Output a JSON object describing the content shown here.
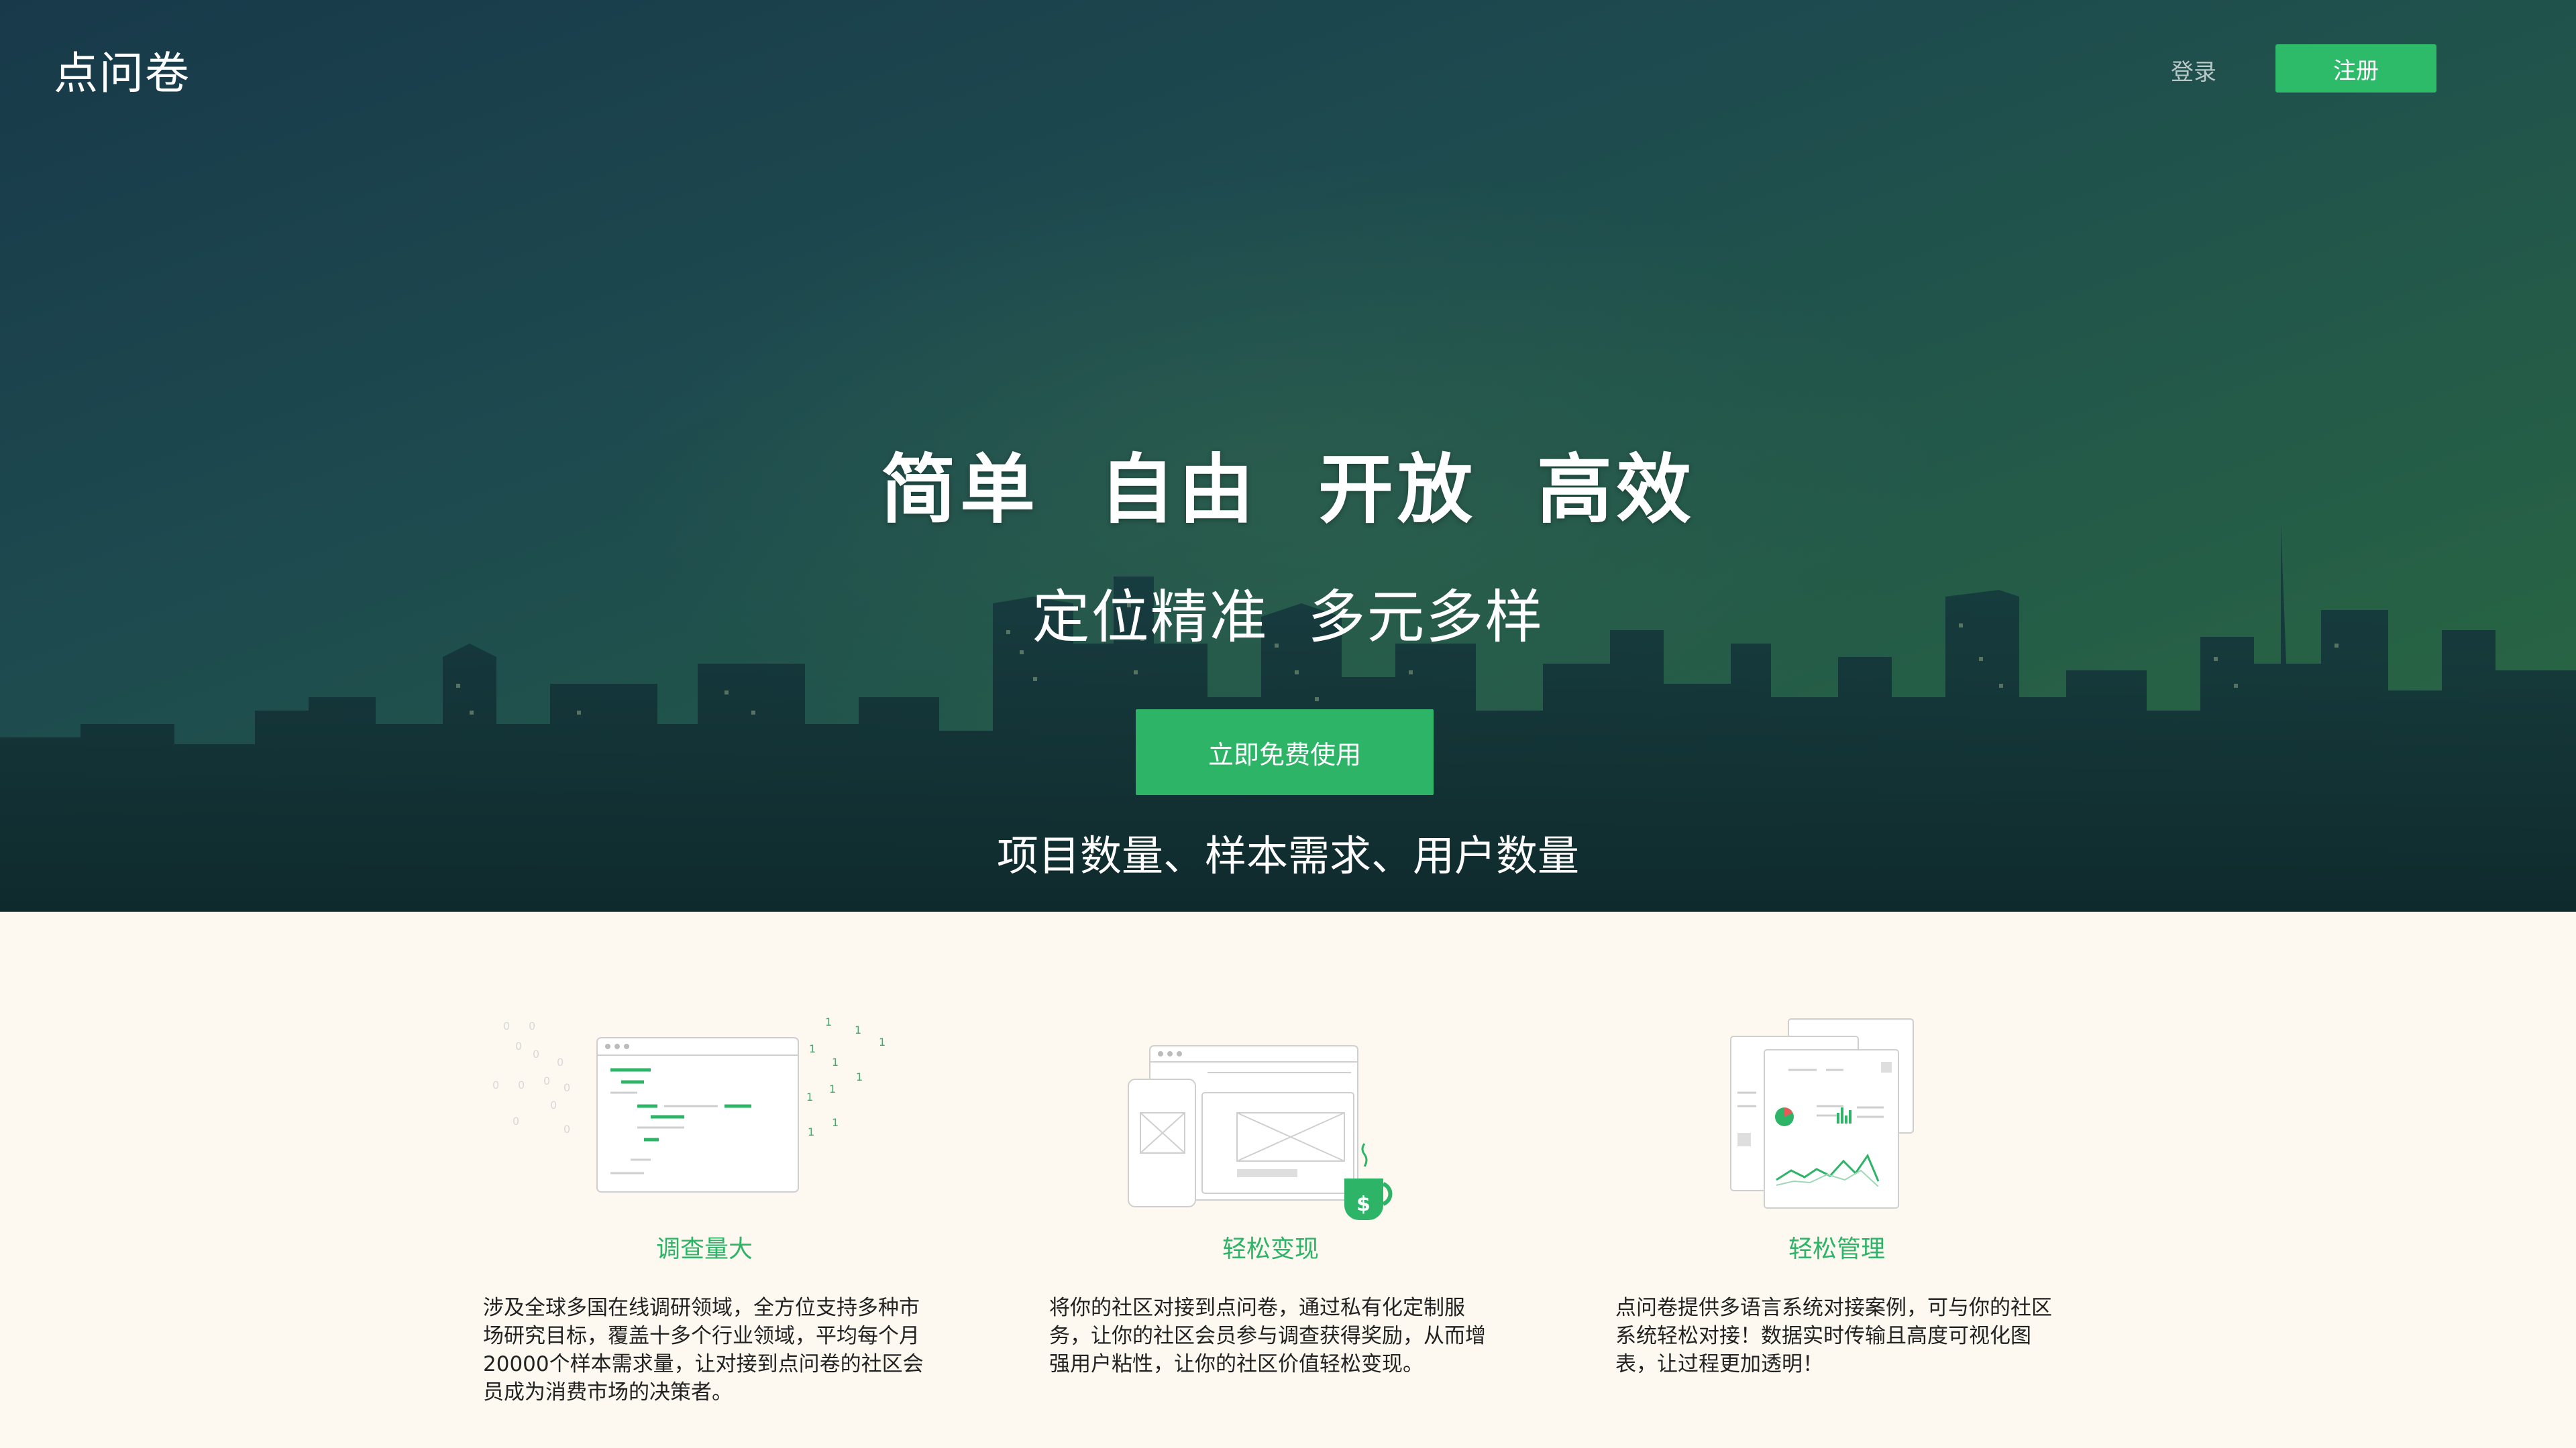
{
  "header": {
    "logo": "点问卷",
    "login_label": "登录",
    "register_label": "注册"
  },
  "hero": {
    "headline": "简单  自由  开放  高效",
    "subheadline": "定位精准  多元多样",
    "cta_label": "立即免费使用",
    "tagline": "项目数量、样本需求、用户数量"
  },
  "features": [
    {
      "title": "调查量大",
      "icon": "survey-window-illustration",
      "description": "涉及全球多国在线调研领域，全方位支持多种市场研究目标，覆盖十多个行业领域，平均每个月20000个样本需求量，让对接到点问卷的社区会员成为消费市场的决策者。"
    },
    {
      "title": "轻松变现",
      "icon": "monetize-devices-illustration",
      "description": "将你的社区对接到点问卷，通过私有化定制服务，让你的社区会员参与调查获得奖励，从而增强用户粘性，让你的社区价值轻松变现。"
    },
    {
      "title": "轻松管理",
      "icon": "dashboard-charts-illustration",
      "description": "点问卷提供多语言系统对接案例，可与你的社区系统轻松对接！数据实时传输且高度可视化图表，让过程更加透明！"
    }
  ],
  "colors": {
    "accent": "#2db467",
    "page_background": "#fdf9f1",
    "hero_dark": "#1d4a4f"
  }
}
